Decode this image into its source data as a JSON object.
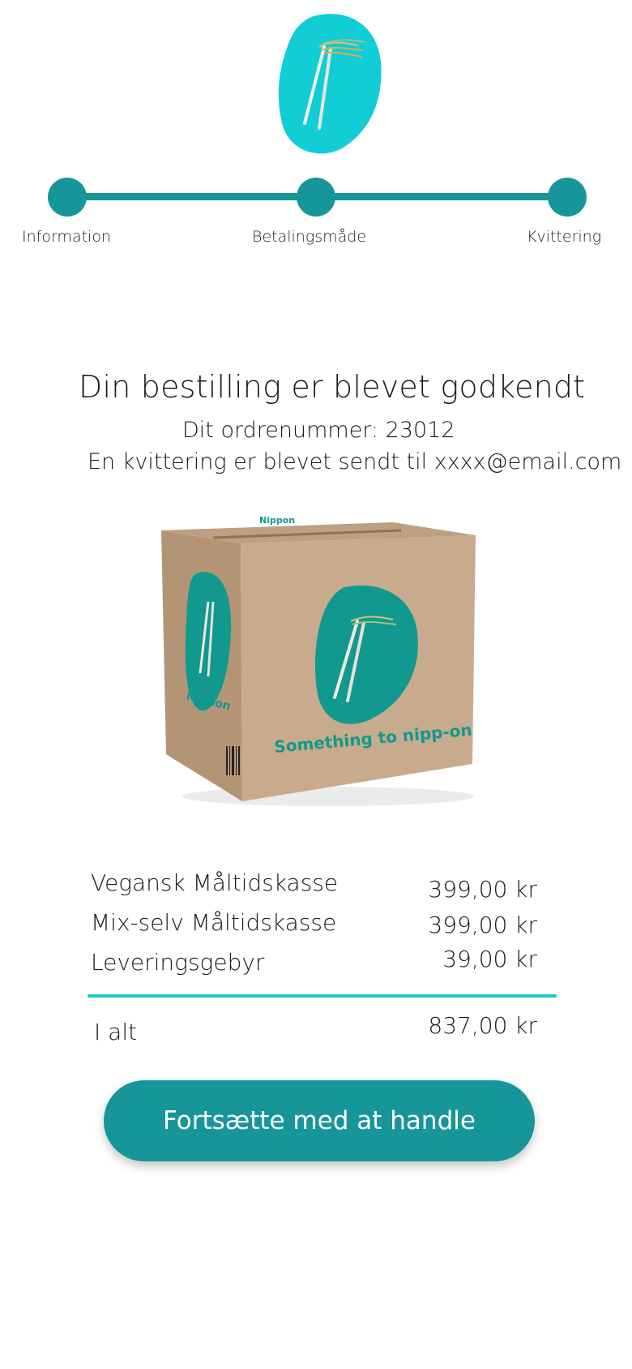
{
  "brand": {
    "logo_icon": "noodle-chopsticks-logo",
    "accent_color": "#17969A",
    "logo_color": "#12CDD6",
    "divider_color": "#1FC6CF"
  },
  "steps": [
    {
      "label": "Information"
    },
    {
      "label": "Betalingsmåde"
    },
    {
      "label": "Kvittering"
    }
  ],
  "confirmation": {
    "title": "Din bestilling er blevet godkendt",
    "order_number": "Dit ordrenummer: 23012",
    "receipt_text": "En kvittering er blevet sendt til xxxx@email.com"
  },
  "box_image": {
    "brand_small": "Nippon",
    "brand_side": "Nippon",
    "slogan": "Something to nipp-on"
  },
  "order": {
    "items": [
      {
        "name": "Vegansk Måltidskasse",
        "price": "399,00 kr"
      },
      {
        "name": "Mix-selv Måltidskasse",
        "price": "399,00 kr"
      },
      {
        "name": "Leveringsgebyr",
        "price": "39,00 kr"
      }
    ],
    "total_label": "I alt",
    "total_value": "837,00 kr"
  },
  "cta": {
    "label": "Fortsætte med at handle"
  }
}
